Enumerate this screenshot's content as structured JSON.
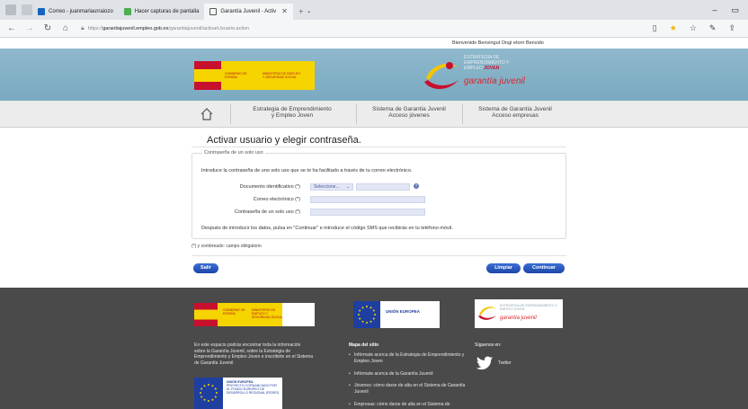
{
  "browser": {
    "tabs": [
      {
        "label": "Correo - juanmariaurraiozo",
        "active": false
      },
      {
        "label": "Hacer capturas de pantalla",
        "active": false
      },
      {
        "label": "Garantía Juvenil - Activ",
        "active": true
      }
    ],
    "url_prefix": "https://",
    "url_host": "garantiajuvenil.empleo.gob.es",
    "url_path": "/garantiajuvenil/activarUsuario.action"
  },
  "userbar": {
    "text": "Bienvenido Benvingut Ongi etorri Benvido"
  },
  "header": {
    "gov_name": "GOBIERNO DE ESPAÑA",
    "ministry": "MINISTERIO DE EMPLEO Y SEGURIDAD SOCIAL",
    "gj_line1": "ESTRATEGIA DE",
    "gj_line2": "EMPRENDIMIENTO Y",
    "gj_line3": "EMPLEO",
    "gj_line3b": "JOVEN",
    "gj_subtitle": "garantía juvenil"
  },
  "nav": {
    "item1_l1": "Estrategia de Emprendimiento",
    "item1_l2": "y Empleo Joven",
    "item2_l1": "Sistema de Garantía Juvenil",
    "item2_l2": "Acceso jóvenes",
    "item3_l1": "Sistema de Garantía Juvenil",
    "item3_l2": "Acceso empresas"
  },
  "page": {
    "title": "Activar usuario y elegir contraseña.",
    "legend": "Contraseña de un solo uso",
    "intro": "Introduce la contraseña de uno solo uso que se te ha facilitado a través de tu correo electrónico.",
    "doc_label": "Documento identificativo (*)",
    "doc_select": "Seleccione...",
    "email_label": "Correo electrónico (*)",
    "otp_label": "Contraseña de un solo uso (*)",
    "after": "Después de introducir los datos, pulsa en \"Continuar\" e introduce el código SMS que recibirás en tu teléfono móvil.",
    "required_note": "(*) y sombreado: campo obligatorio",
    "btn_exit": "Salir",
    "btn_clear": "Limpiar",
    "btn_continue": "Continuar"
  },
  "footer": {
    "gov_name": "GOBIERNO DE ESPAÑA",
    "ministry": "MINISTERIO DE EMPLEO Y SEGURIDAD SOCIAL",
    "eu_name": "UNIÓN EUROPEA",
    "gj_title": "ESTRATEGIA DE EMPRENDIMIENTO Y EMPLEO JOVEN",
    "gj_sub": "garantía juvenil",
    "intro_text": "En este espacio podrás encontrar toda la información sobre la Garantía Juvenil, sobre la Estrategia de Emprendimiento y Empleo Joven e inscribirte en el Sistema de Garantía Juvenil",
    "sitemap_title": "Mapa del sitio",
    "link1": "Infórmate acerca de la Estrategia de Emprendimiento y Empleo Joven",
    "link2": "Infórmate acerca de la Garantía Juvenil",
    "link3": "Jóvenes: cómo darse de alta en el Sistema de Garantía Juvenil",
    "link4": "Empresas: cómo darse de alta en el Sistema de",
    "follow": "Síguenos en:",
    "twitter": "Twitter",
    "eu2_name": "UNIÓN EUROPEA",
    "eu2_text": "PROYECTO COFINANCIADO POR EL FONDO EUROPEO DE DESARROLLO REGIONAL (FEDER)"
  },
  "colors": {
    "header_bg": "#7aaac1",
    "footer_bg": "#4a4a4a",
    "button": "#1c46a8",
    "brand_red": "#d8262e"
  }
}
